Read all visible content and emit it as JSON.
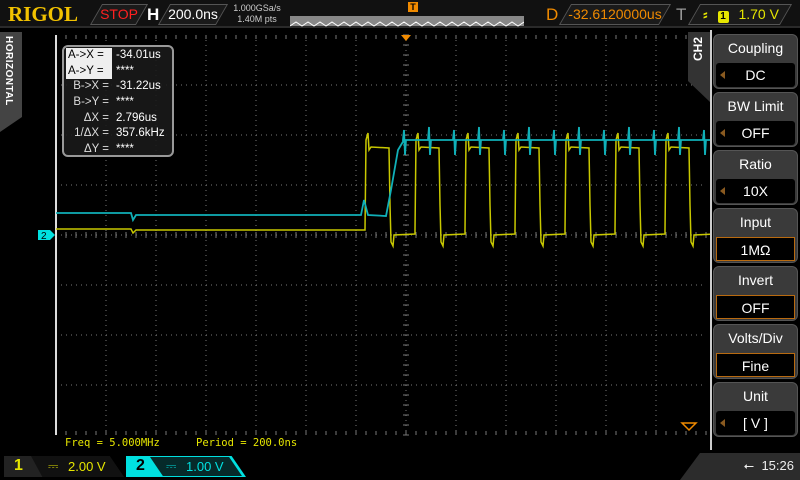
{
  "topbar": {
    "logo": "RIGOL",
    "run_state": "STOP",
    "h_label": "H",
    "timebase": "200.0ns",
    "sample_rate": "1.000GSa/s",
    "memory_depth": "1.40M pts",
    "d_label": "D",
    "delay": "-32.6120000us",
    "t_label": "T",
    "trigger_source": "1",
    "trigger_level": "1.70 V",
    "trigger_marker": "T"
  },
  "side_tab": "HORIZONTAL",
  "cursors": [
    {
      "key": "A->X =",
      "value": "-34.01us"
    },
    {
      "key": "A->Y =",
      "value": "****"
    },
    {
      "key": "B->X =",
      "value": "-31.22us"
    },
    {
      "key": "B->Y =",
      "value": "****"
    },
    {
      "key": "ΔX =",
      "value": "2.796us"
    },
    {
      "key": "1/ΔX =",
      "value": "357.6kHz"
    },
    {
      "key": "ΔY =",
      "value": "****"
    }
  ],
  "ch2_marker": "2",
  "menu": {
    "title": "CH2",
    "items": [
      {
        "label": "Coupling",
        "value": "DC"
      },
      {
        "label": "BW Limit",
        "value": "OFF"
      },
      {
        "label": "Ratio",
        "value": "10X"
      },
      {
        "label": "Input",
        "value": "1MΩ"
      },
      {
        "label": "Invert",
        "value": "OFF"
      },
      {
        "label": "Volts/Div",
        "value": "Fine"
      },
      {
        "label": "Unit",
        "value": "[  V  ]"
      }
    ]
  },
  "measurements": {
    "freq": "Freq = 5.000MHz",
    "period": "Period = 200.0ns"
  },
  "channels": [
    {
      "num": "1",
      "scale": "2.00 V",
      "color": "#e6e600"
    },
    {
      "num": "2",
      "scale": "1.00 V",
      "color": "#00e0e0"
    }
  ],
  "status": {
    "time": "15:26"
  },
  "colors": {
    "ch1": "#c8c800",
    "ch2": "#10b0b8",
    "trigger": "#f08a00"
  }
}
